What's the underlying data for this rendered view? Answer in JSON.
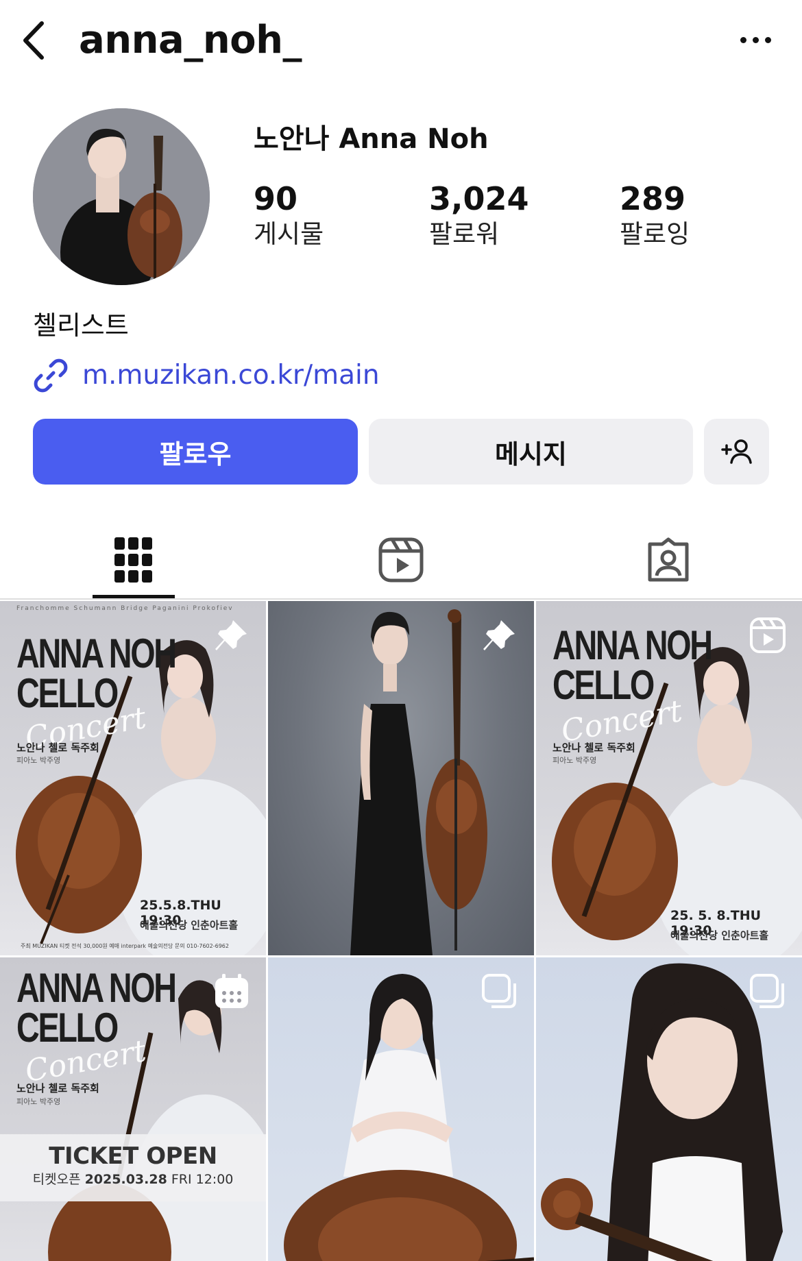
{
  "header": {
    "username": "anna_noh_"
  },
  "profile": {
    "display_name": "노안나 Anna Noh",
    "stats": [
      {
        "value": "90",
        "label": "게시물"
      },
      {
        "value": "3,024",
        "label": "팔로워"
      },
      {
        "value": "289",
        "label": "팔로잉"
      }
    ],
    "bio": "첼리스트",
    "link": "m.muzikan.co.kr/main"
  },
  "actions": {
    "follow": "팔로우",
    "message": "메시지"
  },
  "tabs": {
    "active": "grid",
    "items": [
      "grid-icon",
      "reels-icon",
      "tagged-icon"
    ]
  },
  "posts": [
    {
      "badge": "pin-icon",
      "composers": "Franchomme  Schumann  Bridge  Paganini  Prokofiev",
      "title_line1": "ANNA NOH",
      "title_line2": "CELLO",
      "script": "Concert",
      "subtitle": "노안나 첼로 독주회",
      "pianist": "피아노 박주영",
      "date": "25.5.8.THU 19:30",
      "venue": "예술의전당 인춘아트홀",
      "footer": "주최 MUZIKAN  티켓 전석 30,000원  예매 interpark 예술의전당  문의 010-7602-6962"
    },
    {
      "badge": "pin-icon"
    },
    {
      "badge": "reel-icon",
      "title_line1": "ANNA NOH",
      "title_line2": "CELLO",
      "script": "Concert",
      "subtitle": "노안나 첼로 독주회",
      "pianist": "피아노 박주영",
      "date": "25. 5. 8.THU 19:30",
      "venue": "예술의전당 인춘아트홀"
    },
    {
      "badge": "calendar-icon",
      "title_line1": "ANNA NOH",
      "title_line2": "CELLO",
      "script": "Concert",
      "subtitle": "노안나 첼로 독주회",
      "pianist": "피아노 박주영",
      "ticket_title": "TICKET OPEN",
      "ticket_prefix": "티켓오픈",
      "ticket_date": "2025.03.28",
      "ticket_time": "FRI 12:00"
    },
    {
      "badge": "carousel-icon"
    },
    {
      "badge": "carousel-icon"
    }
  ],
  "colors": {
    "accent": "#4a5df0",
    "link": "#3b48d6",
    "button_gray": "#efeff2"
  }
}
